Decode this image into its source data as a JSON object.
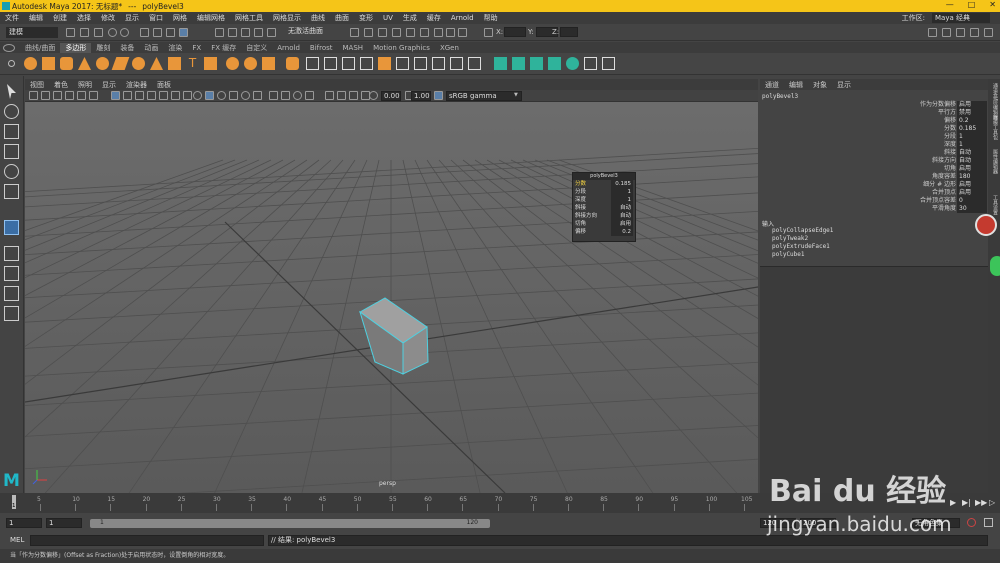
{
  "window": {
    "title": "Autodesk Maya 2017: 无标题*",
    "dashes": "---",
    "object": "polyBevel3"
  },
  "menubar": {
    "items": [
      "文件",
      "编辑",
      "创建",
      "选择",
      "修改",
      "显示",
      "窗口",
      "网格",
      "编辑网格",
      "网格工具",
      "网格显示",
      "曲线",
      "曲面",
      "变形",
      "UV",
      "生成",
      "缓存",
      "Arnold",
      "帮助"
    ],
    "workspace_label": "工作区:",
    "workspace_value": "Maya 经典"
  },
  "statusline": {
    "mode": "建模",
    "live_surface": "无激活曲面",
    "x_label": "X:",
    "y_label": "Y:",
    "z_label": "Z:"
  },
  "shelf_tabs": [
    "曲线/曲面",
    "多边形",
    "雕刻",
    "装备",
    "动画",
    "渲染",
    "FX",
    "FX 缓存",
    "自定义",
    "Arnold",
    "Bifrost",
    "MASH",
    "Motion Graphics",
    "XGen"
  ],
  "shelf_active": 1,
  "panel_menu": [
    "视图",
    "着色",
    "照明",
    "显示",
    "渲染器",
    "面板"
  ],
  "panel_tools": {
    "exposure": "0.00",
    "gamma": "1.00",
    "colorspace": "sRGB gamma"
  },
  "viewport": {
    "camera": "persp"
  },
  "bevel_window": {
    "title": "polyBevel3",
    "rows": [
      {
        "k": "分数",
        "v": "0.185"
      },
      {
        "k": "分段",
        "v": "1"
      },
      {
        "k": "深度",
        "v": "1"
      },
      {
        "k": "斜接",
        "v": "自动"
      },
      {
        "k": "斜接方向",
        "v": "自动"
      },
      {
        "k": "切角",
        "v": "启用"
      },
      {
        "k": "偏移",
        "v": "0.2"
      }
    ]
  },
  "channel_box": {
    "menu": [
      "通道",
      "编辑",
      "对象",
      "显示"
    ],
    "node": "polyBevel3",
    "attrs": [
      {
        "k": "作为分数偏移",
        "v": "启用"
      },
      {
        "k": "平行方",
        "v": "禁用"
      },
      {
        "k": "偏移",
        "v": "0.2"
      },
      {
        "k": "分数",
        "v": "0.185"
      },
      {
        "k": "分段",
        "v": "1"
      },
      {
        "k": "深度",
        "v": "1"
      },
      {
        "k": "斜接",
        "v": "自动"
      },
      {
        "k": "斜接方向",
        "v": "自动"
      },
      {
        "k": "切角",
        "v": "启用"
      },
      {
        "k": "角度容差",
        "v": "180"
      },
      {
        "k": "细分 # 边形",
        "v": "启用"
      },
      {
        "k": "合并顶点",
        "v": "启用"
      },
      {
        "k": "合并顶点容差",
        "v": "0"
      },
      {
        "k": "平滑角度",
        "v": "30"
      }
    ],
    "inputs_label": "输入",
    "inputs": [
      "polyCollapseEdge1",
      "polyTweak2",
      "polyExtrudeFace1",
      "polyCube1"
    ]
  },
  "side_tabs": [
    "通道盒/层编辑器",
    "建模工具包",
    "属性编辑器",
    "工具设置"
  ],
  "timeline": {
    "ticks": [
      "5",
      "10",
      "15",
      "20",
      "25",
      "30",
      "35",
      "40",
      "45",
      "50",
      "55",
      "60",
      "65",
      "70",
      "75",
      "80",
      "85",
      "90",
      "95",
      "100",
      "105"
    ],
    "first": "1",
    "current": "1"
  },
  "range": {
    "start": "1",
    "inner_start": "1",
    "slider_start": "1",
    "slider_end": "120",
    "end1": "120",
    "end2": "200",
    "charset": "无角色集"
  },
  "command": {
    "lang": "MEL",
    "result": "// 结果: polyBevel3"
  },
  "helpline": "当「作为分数偏移」(Offset as Fraction)处于启用状态时，设置倒角的相对宽度。",
  "watermark": {
    "brand": "Bai du 经验",
    "url": "jingyan.baidu.com"
  },
  "colors": {
    "title_bg": "#f5c518",
    "selection_cyan": "#4fd0e0",
    "maya_logo": "#20b8c8"
  }
}
